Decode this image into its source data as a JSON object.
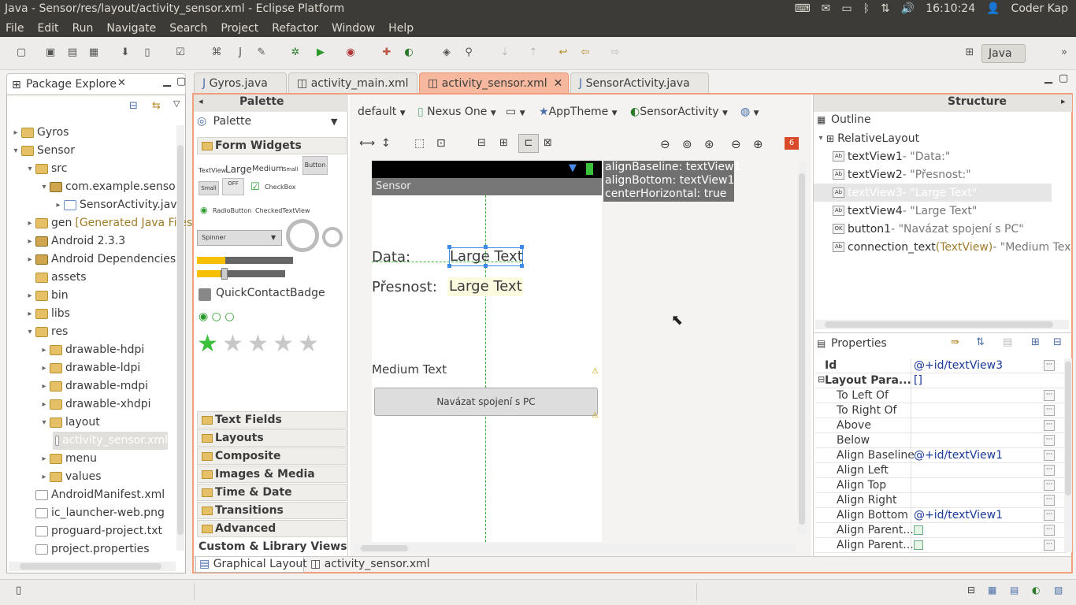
{
  "window": {
    "title": "Java - Sensor/res/layout/activity_sensor.xml - Eclipse Platform",
    "clock": "16:10:24",
    "user": "Coder Kap"
  },
  "menu": [
    "File",
    "Edit",
    "Run",
    "Navigate",
    "Search",
    "Project",
    "Refactor",
    "Window",
    "Help"
  ],
  "perspective": "Java",
  "package_explorer": {
    "title": "Package Explore",
    "items": [
      {
        "label": "Gyros",
        "depth": 0,
        "arrow": "▸",
        "icon": "folder"
      },
      {
        "label": "Sensor",
        "depth": 0,
        "arrow": "▾",
        "icon": "folder"
      },
      {
        "label": "src",
        "depth": 1,
        "arrow": "▾",
        "icon": "folder"
      },
      {
        "label": "com.example.sensor",
        "depth": 2,
        "arrow": "▾",
        "icon": "pkg"
      },
      {
        "label": "SensorActivity.java",
        "depth": 3,
        "arrow": "▸",
        "icon": "java"
      },
      {
        "label": "gen",
        "extra": "[Generated Java Files]",
        "depth": 1,
        "arrow": "▸",
        "icon": "folder"
      },
      {
        "label": "Android 2.3.3",
        "depth": 1,
        "arrow": "▸",
        "icon": "pkg"
      },
      {
        "label": "Android Dependencies",
        "depth": 1,
        "arrow": "▸",
        "icon": "pkg"
      },
      {
        "label": "assets",
        "depth": 1,
        "arrow": "",
        "icon": "folder"
      },
      {
        "label": "bin",
        "depth": 1,
        "arrow": "▸",
        "icon": "folder"
      },
      {
        "label": "libs",
        "depth": 1,
        "arrow": "▸",
        "icon": "folder"
      },
      {
        "label": "res",
        "depth": 1,
        "arrow": "▾",
        "icon": "folder"
      },
      {
        "label": "drawable-hdpi",
        "depth": 2,
        "arrow": "▸",
        "icon": "folder"
      },
      {
        "label": "drawable-ldpi",
        "depth": 2,
        "arrow": "▸",
        "icon": "folder"
      },
      {
        "label": "drawable-mdpi",
        "depth": 2,
        "arrow": "▸",
        "icon": "folder"
      },
      {
        "label": "drawable-xhdpi",
        "depth": 2,
        "arrow": "▸",
        "icon": "folder"
      },
      {
        "label": "layout",
        "depth": 2,
        "arrow": "▾",
        "icon": "folder"
      },
      {
        "label": "activity_sensor.xml",
        "depth": 3,
        "arrow": "",
        "icon": "xml",
        "selected": true
      },
      {
        "label": "menu",
        "depth": 2,
        "arrow": "▸",
        "icon": "folder"
      },
      {
        "label": "values",
        "depth": 2,
        "arrow": "▸",
        "icon": "folder"
      },
      {
        "label": "AndroidManifest.xml",
        "depth": 1,
        "arrow": "",
        "icon": "xml"
      },
      {
        "label": "ic_launcher-web.png",
        "depth": 1,
        "arrow": "",
        "icon": "xml"
      },
      {
        "label": "proguard-project.txt",
        "depth": 1,
        "arrow": "",
        "icon": "xml"
      },
      {
        "label": "project.properties",
        "depth": 1,
        "arrow": "",
        "icon": "xml"
      }
    ]
  },
  "editor_tabs": [
    "Gyros.java",
    "activity_main.xml",
    "activity_sensor.xml",
    "SensorActivity.java"
  ],
  "palette": {
    "header": "Palette",
    "dropdown": "Palette",
    "open_category": "Form Widgets",
    "widgets": {
      "textview": "TextView",
      "large": "Large",
      "medium": "Medium",
      "small": "Small",
      "button": "Button",
      "small_btn": "Small",
      "toggle": "OFF",
      "checkbox": "CheckBox",
      "radio": "RadioButton",
      "checked_tv": "CheckedTextView",
      "spinner": "Spinner",
      "qcb": "QuickContactBadge"
    },
    "categories": [
      "Text Fields",
      "Layouts",
      "Composite",
      "Images & Media",
      "Time & Date",
      "Transitions",
      "Advanced"
    ],
    "custom": "Custom & Library Views"
  },
  "canvas_toolbar": {
    "config": "default",
    "device": "Nexus One",
    "theme": "AppTheme",
    "activity": "SensorActivity",
    "warnings": "6"
  },
  "device": {
    "app_title": "Sensor",
    "label_data": "Data:",
    "value_data": "Large Text",
    "label_precision": "Přesnost:",
    "value_precision": "Large Text",
    "medium": "Medium Text",
    "button": "Navázat spojení s PC"
  },
  "tooltip": [
    "alignBaseline: textView1",
    "alignBottom: textView1",
    "centerHorizontal: true"
  ],
  "structure": {
    "header": "Structure",
    "outline_title": "Outline",
    "root": "RelativeLayout",
    "children": [
      {
        "name": "textView1",
        "type": "",
        "text": " - \"Data:\"",
        "icon": "Ab"
      },
      {
        "name": "textView2",
        "type": "",
        "text": " - \"Přesnost:\"",
        "icon": "Ab"
      },
      {
        "name": "textView3",
        "type": "",
        "text": " - \"Large Text\"",
        "icon": "Ab",
        "selected": true
      },
      {
        "name": "textView4",
        "type": "",
        "text": " - \"Large Text\"",
        "icon": "Ab"
      },
      {
        "name": "button1",
        "type": "",
        "text": " - \"Navázat spojení s PC\"",
        "icon": "OK"
      },
      {
        "name": "connection_text",
        "type": " (TextView)",
        "text": " - \"Medium Tex",
        "icon": "Ab"
      }
    ]
  },
  "properties": {
    "title": "Properties",
    "rows": [
      {
        "k": "Id",
        "v": "@+id/textView3",
        "bold": true,
        "dots": true
      },
      {
        "k": "Layout Para...",
        "v": "[]",
        "bold": true,
        "group": true
      },
      {
        "k": "To Left Of",
        "v": "",
        "dots": true
      },
      {
        "k": "To Right Of",
        "v": "",
        "dots": true
      },
      {
        "k": "Above",
        "v": "",
        "dots": true
      },
      {
        "k": "Below",
        "v": "",
        "dots": true
      },
      {
        "k": "Align Baseline",
        "v": "@+id/textView1",
        "dots": true
      },
      {
        "k": "Align Left",
        "v": "",
        "dots": true
      },
      {
        "k": "Align Top",
        "v": "",
        "dots": true
      },
      {
        "k": "Align Right",
        "v": "",
        "dots": true
      },
      {
        "k": "Align Bottom",
        "v": "@+id/textView1",
        "dots": true
      },
      {
        "k": "Align Parent...",
        "v": "",
        "dots": true,
        "check": true
      },
      {
        "k": "Align Parent...",
        "v": "",
        "dots": true,
        "check": true
      }
    ]
  },
  "bottom_tabs": [
    "Graphical Layout",
    "activity_sensor.xml"
  ]
}
